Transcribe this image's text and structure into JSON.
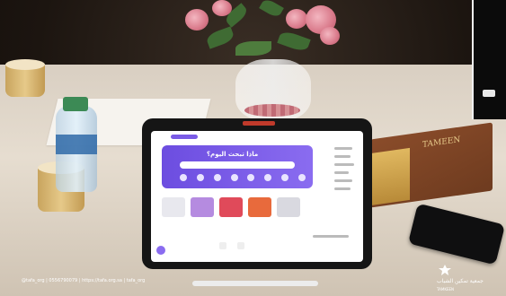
{
  "photo": {
    "tablet_banner_text": "ماذا تبحث اليوم؟",
    "box_brand_text": "TAMEEN"
  },
  "footer": {
    "handles": "@tafa_org   |   0556790079   |   https://tafa.org.sa   |   tafa_org",
    "brand_arabic": "جمعية تمكين الشباب",
    "brand_english": "TAMKEEN"
  },
  "colors": {
    "banner_purple": "#7a5be6",
    "accent_gold": "#e0b860",
    "table_wood": "#d9cfc2"
  },
  "icons": [
    "flowers-icon",
    "water-bottle-icon",
    "paper-cup-icon",
    "tablet-icon",
    "phone-icon",
    "stylus-icon",
    "social-icon",
    "brand-logo-icon"
  ]
}
